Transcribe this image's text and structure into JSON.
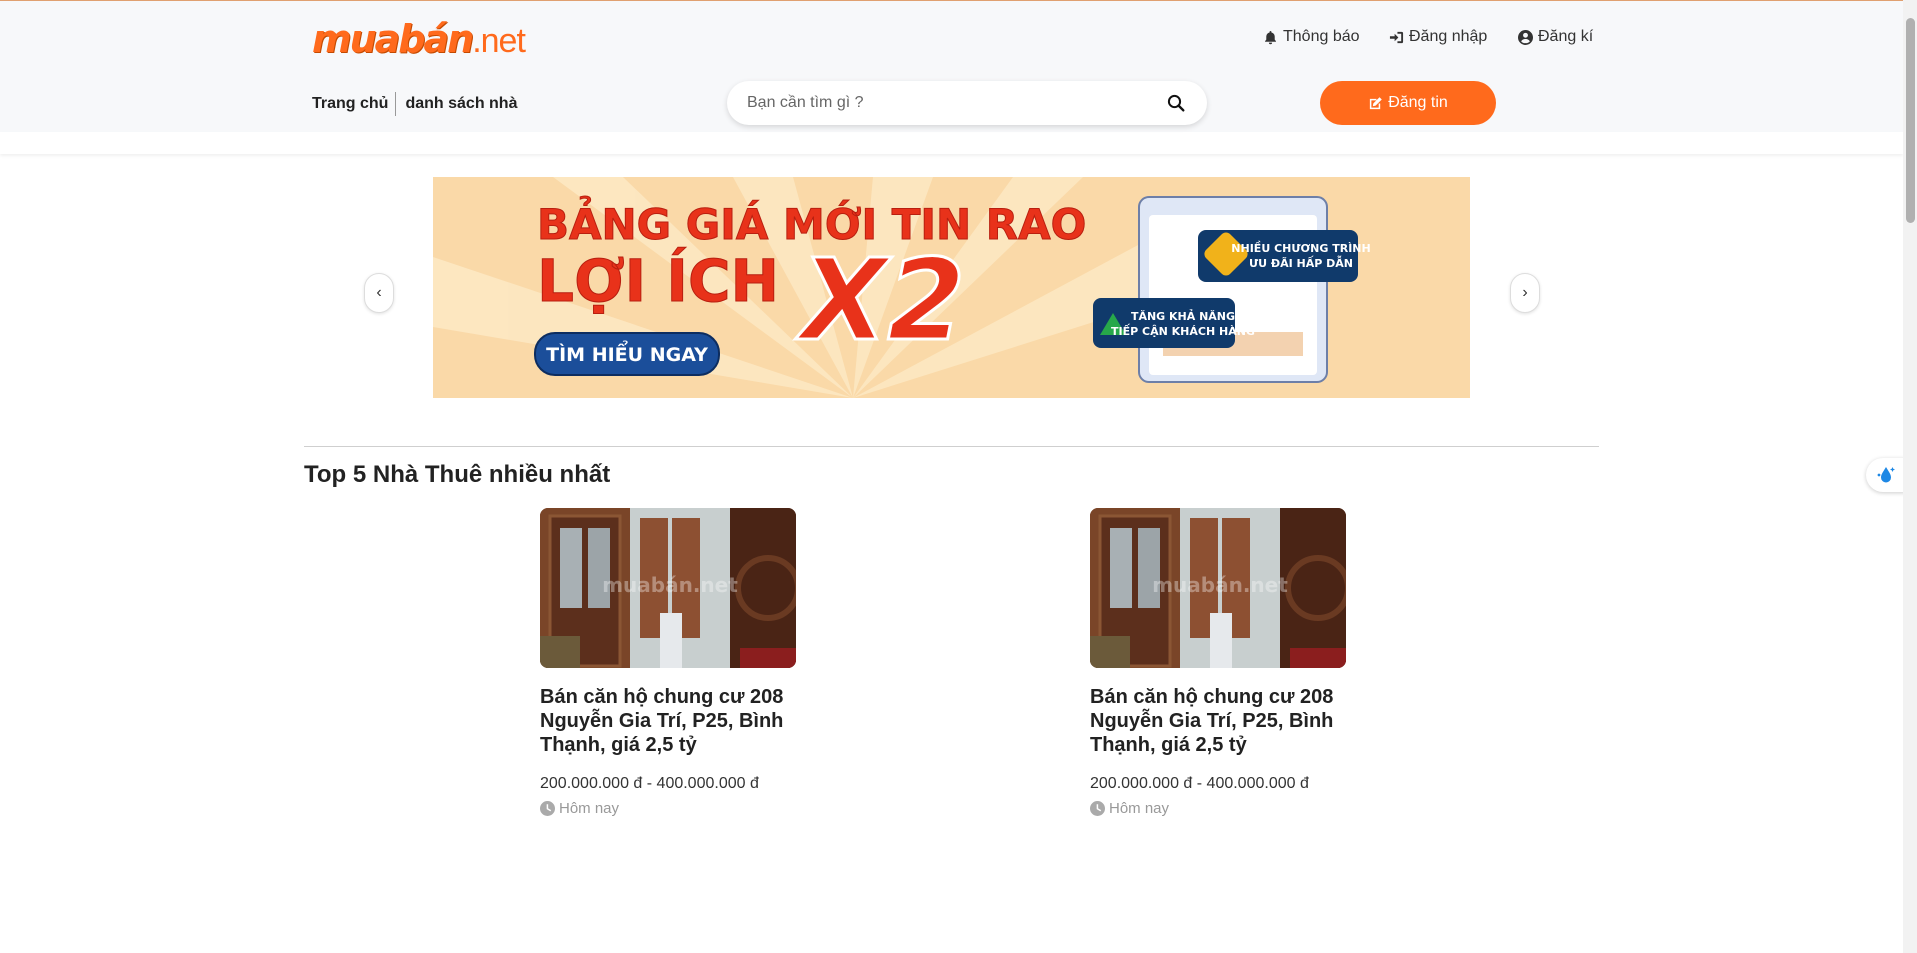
{
  "header": {
    "logo": {
      "main": "muabán",
      "suffix": ".net"
    },
    "links": {
      "notifications": "Thông báo",
      "login": "Đăng nhập",
      "register": "Đăng kí"
    },
    "nav": {
      "home": "Trang chủ",
      "house_list": "danh sách nhà"
    },
    "search": {
      "placeholder": "Bạn cần tìm gì ?"
    },
    "post_button": "Đăng tin"
  },
  "banner": {
    "headline_1": "BẢNG GIÁ MỚI TIN RAO",
    "headline_2": "LỢI ÍCH",
    "multiplier": "X2",
    "cta": "TÌM HIỂU NGAY",
    "badge_1_line_1": "NHIỀU CHƯƠNG TRÌNH",
    "badge_1_line_2": "ƯU ĐÃI HẤP DẪN",
    "badge_2_line_1": "TĂNG KHẢ NĂNG",
    "badge_2_line_2": "TIẾP CẬN KHÁCH HÀNG",
    "prev_icon": "chevron-left-icon",
    "next_icon": "chevron-right-icon"
  },
  "section": {
    "title": "Top 5 Nhà Thuê nhiều nhất",
    "cards": [
      {
        "title": "Bán căn hộ chung cư 208 Nguyễn Gia Trí, P25, Bình Thạnh, giá 2,5 tỷ",
        "price": "200.000.000 đ - 400.000.000 đ",
        "time": "Hôm nay",
        "watermark": "muabán.net"
      },
      {
        "title": "Bán căn hộ chung cư 208 Nguyễn Gia Trí, P25, Bình Thạnh, giá 2,5 tỷ",
        "price": "200.000.000 đ - 400.000.000 đ",
        "time": "Hôm nay",
        "watermark": "muabán.net"
      }
    ]
  },
  "colors": {
    "brand": "#ff6a1c",
    "header_bg": "#f7f8fa",
    "banner_bg": "#fad9a8",
    "banner_text": "#e8321a"
  }
}
